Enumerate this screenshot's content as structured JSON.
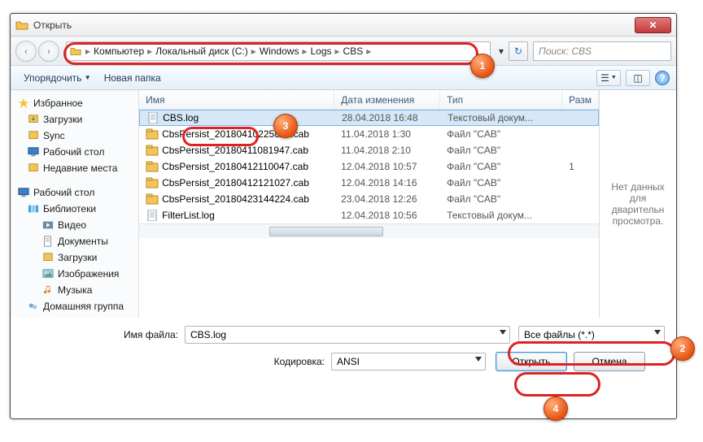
{
  "window": {
    "title": "Открыть",
    "close_x": "✕"
  },
  "nav": {
    "back": "‹",
    "fwd": "›",
    "breadcrumb": [
      "Компьютер",
      "Локальный диск (C:)",
      "Windows",
      "Logs",
      "CBS"
    ],
    "search_placeholder": "Поиск: CBS",
    "refresh": "↻"
  },
  "toolbar": {
    "organize": "Упорядочить",
    "newfolder": "Новая папка",
    "help": "?"
  },
  "sidebar": {
    "favorites": {
      "title": "Избранное",
      "items": [
        "Загрузки",
        "Sync",
        "Рабочий стол",
        "Недавние места"
      ]
    },
    "desktop": {
      "title": "Рабочий стол",
      "libraries": {
        "title": "Библиотеки",
        "items": [
          "Видео",
          "Документы",
          "Загрузки",
          "Изображения",
          "Музыка"
        ]
      },
      "homegroup": "Домашняя группа"
    }
  },
  "columns": {
    "name": "Имя",
    "date": "Дата изменения",
    "type": "Тип",
    "size": "Разм"
  },
  "files": [
    {
      "name": "CBS.log",
      "date": "28.04.2018 16:48",
      "type": "Текстовый докум...",
      "size": "",
      "icon": "text",
      "selected": true
    },
    {
      "name": "CbsPersist_20180410225824.cab",
      "date": "11.04.2018 1:30",
      "type": "Файл \"CAB\"",
      "size": "",
      "icon": "cab"
    },
    {
      "name": "CbsPersist_20180411081947.cab",
      "date": "11.04.2018 2:10",
      "type": "Файл \"CAB\"",
      "size": "",
      "icon": "cab"
    },
    {
      "name": "CbsPersist_20180412110047.cab",
      "date": "12.04.2018 10:57",
      "type": "Файл \"CAB\"",
      "size": "1",
      "icon": "cab"
    },
    {
      "name": "CbsPersist_20180412121027.cab",
      "date": "12.04.2018 14:16",
      "type": "Файл \"CAB\"",
      "size": "",
      "icon": "cab"
    },
    {
      "name": "CbsPersist_20180423144224.cab",
      "date": "23.04.2018 12:26",
      "type": "Файл \"CAB\"",
      "size": "",
      "icon": "cab"
    },
    {
      "name": "FilterList.log",
      "date": "12.04.2018 10:56",
      "type": "Текстовый докум...",
      "size": "",
      "icon": "text"
    }
  ],
  "preview": "Нет данных для дварительн просмотра.",
  "footer": {
    "filename_label": "Имя файла:",
    "filename_value": "CBS.log",
    "encoding_label": "Кодировка:",
    "encoding_value": "ANSI",
    "filter_value": "Все файлы  (*.*)",
    "open": "Открыть",
    "cancel": "Отмена"
  },
  "badges": {
    "b1": "1",
    "b2": "2",
    "b3": "3",
    "b4": "4"
  }
}
